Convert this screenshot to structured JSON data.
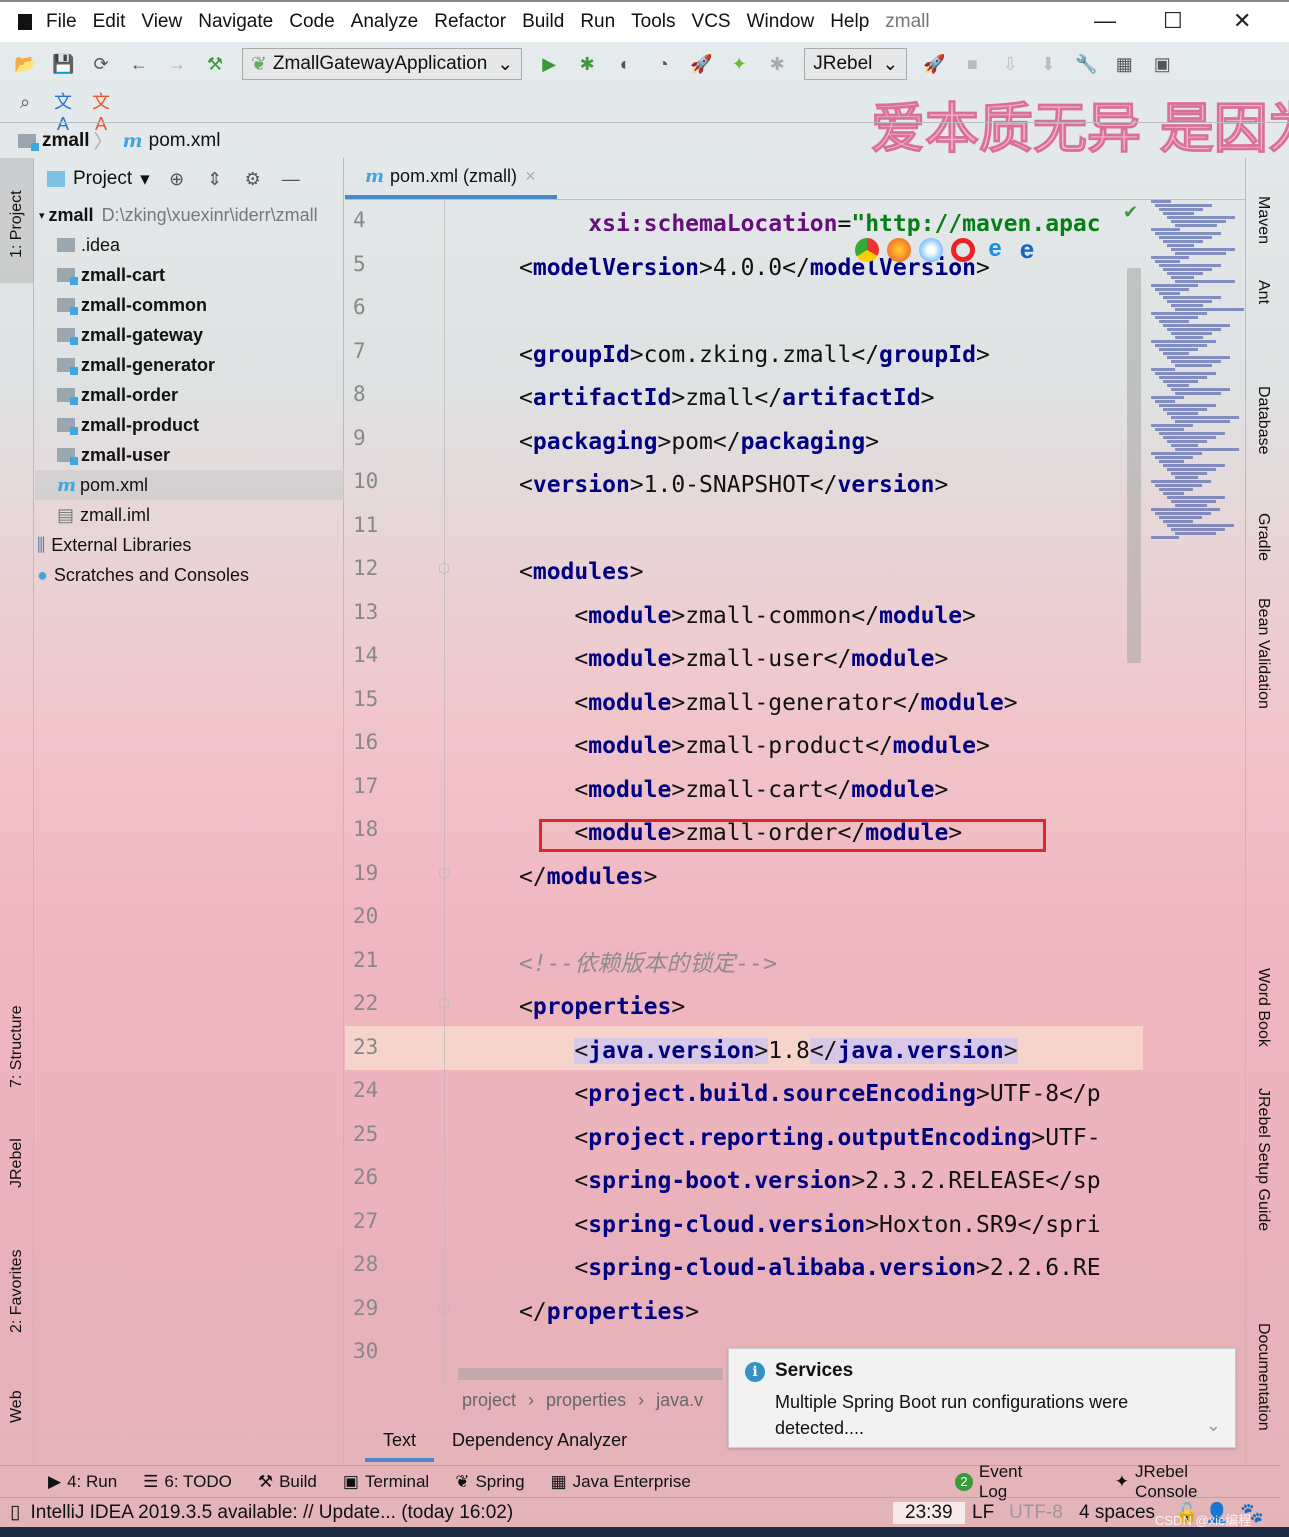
{
  "window": {
    "title": "zmall",
    "menu": [
      "File",
      "Edit",
      "View",
      "Navigate",
      "Code",
      "Analyze",
      "Refactor",
      "Build",
      "Run",
      "Tools",
      "VCS",
      "Window",
      "Help"
    ]
  },
  "toolbar": {
    "run_config": "ZmallGatewayApplication",
    "jrebel": "JRebel"
  },
  "watermark": "爱本质无异 是因为",
  "navbar": {
    "project": "zmall",
    "file": "pom.xml"
  },
  "left_stripe": [
    "1: Project",
    "7: Structure",
    "JRebel",
    "2: Favorites",
    "Web"
  ],
  "right_stripe": [
    "Maven",
    "Ant",
    "Database",
    "Gradle",
    "Bean Validation",
    "Word Book",
    "JRebel Setup Guide",
    "Documentation"
  ],
  "project_panel": {
    "title": "Project",
    "root": "zmall",
    "root_path": "D:\\zking\\xuexinr\\iderr\\zmall",
    "items": [
      {
        "label": ".idea",
        "type": "folder"
      },
      {
        "label": "zmall-cart",
        "type": "module"
      },
      {
        "label": "zmall-common",
        "type": "module"
      },
      {
        "label": "zmall-gateway",
        "type": "module"
      },
      {
        "label": "zmall-generator",
        "type": "module"
      },
      {
        "label": "zmall-order",
        "type": "module"
      },
      {
        "label": "zmall-product",
        "type": "module"
      },
      {
        "label": "zmall-user",
        "type": "module"
      },
      {
        "label": "pom.xml",
        "type": "maven",
        "selected": true
      },
      {
        "label": "zmall.iml",
        "type": "file"
      },
      {
        "label": "External Libraries",
        "type": "lib"
      },
      {
        "label": "Scratches and Consoles",
        "type": "scratch"
      }
    ]
  },
  "editor": {
    "tab": "pom.xml (zmall)",
    "current_line": 23,
    "lines": [
      {
        "n": "4",
        "indent": 5,
        "segs": [
          [
            "attr",
            "xsi:schemaLocation"
          ],
          [
            "txt",
            "="
          ],
          [
            "str",
            "\"http://maven.apac"
          ]
        ]
      },
      {
        "n": "5",
        "indent": 0,
        "segs": [
          [
            "txt",
            "<"
          ],
          [
            "tag",
            "modelVersion"
          ],
          [
            "txt",
            ">4.0.0</"
          ],
          [
            "tag",
            "modelVersion"
          ],
          [
            "txt",
            ">"
          ]
        ]
      },
      {
        "n": "6",
        "indent": 0,
        "segs": []
      },
      {
        "n": "7",
        "indent": 0,
        "segs": [
          [
            "txt",
            "<"
          ],
          [
            "tag",
            "groupId"
          ],
          [
            "txt",
            ">com.zking.zmall</"
          ],
          [
            "tag",
            "groupId"
          ],
          [
            "txt",
            ">"
          ]
        ]
      },
      {
        "n": "8",
        "indent": 0,
        "segs": [
          [
            "txt",
            "<"
          ],
          [
            "tag",
            "artifactId"
          ],
          [
            "txt",
            ">zmall</"
          ],
          [
            "tag",
            "artifactId"
          ],
          [
            "txt",
            ">"
          ]
        ]
      },
      {
        "n": "9",
        "indent": 0,
        "segs": [
          [
            "txt",
            "<"
          ],
          [
            "tag",
            "packaging"
          ],
          [
            "txt",
            ">pom</"
          ],
          [
            "tag",
            "packaging"
          ],
          [
            "txt",
            ">"
          ]
        ]
      },
      {
        "n": "10",
        "indent": 0,
        "segs": [
          [
            "txt",
            "<"
          ],
          [
            "tag",
            "version"
          ],
          [
            "txt",
            ">1.0-SNAPSHOT</"
          ],
          [
            "tag",
            "version"
          ],
          [
            "txt",
            ">"
          ]
        ]
      },
      {
        "n": "11",
        "indent": 0,
        "segs": []
      },
      {
        "n": "12",
        "indent": 0,
        "segs": [
          [
            "txt",
            "<"
          ],
          [
            "tag",
            "modules"
          ],
          [
            "txt",
            ">"
          ]
        ]
      },
      {
        "n": "13",
        "indent": 4,
        "segs": [
          [
            "txt",
            "<"
          ],
          [
            "tag",
            "module"
          ],
          [
            "txt",
            ">zmall-common</"
          ],
          [
            "tag",
            "module"
          ],
          [
            "txt",
            ">"
          ]
        ]
      },
      {
        "n": "14",
        "indent": 4,
        "segs": [
          [
            "txt",
            "<"
          ],
          [
            "tag",
            "module"
          ],
          [
            "txt",
            ">zmall-user</"
          ],
          [
            "tag",
            "module"
          ],
          [
            "txt",
            ">"
          ]
        ]
      },
      {
        "n": "15",
        "indent": 4,
        "segs": [
          [
            "txt",
            "<"
          ],
          [
            "tag",
            "module"
          ],
          [
            "txt",
            ">zmall-generator</"
          ],
          [
            "tag",
            "module"
          ],
          [
            "txt",
            ">"
          ]
        ]
      },
      {
        "n": "16",
        "indent": 4,
        "segs": [
          [
            "txt",
            "<"
          ],
          [
            "tag",
            "module"
          ],
          [
            "txt",
            ">zmall-product</"
          ],
          [
            "tag",
            "module"
          ],
          [
            "txt",
            ">"
          ]
        ]
      },
      {
        "n": "17",
        "indent": 4,
        "segs": [
          [
            "txt",
            "<"
          ],
          [
            "tag",
            "module"
          ],
          [
            "txt",
            ">zmall-cart</"
          ],
          [
            "tag",
            "module"
          ],
          [
            "txt",
            ">"
          ]
        ]
      },
      {
        "n": "18",
        "indent": 4,
        "segs": [
          [
            "txt",
            "<"
          ],
          [
            "tag",
            "module"
          ],
          [
            "txt",
            ">zmall-order</"
          ],
          [
            "tag",
            "module"
          ],
          [
            "txt",
            ">"
          ]
        ]
      },
      {
        "n": "19",
        "indent": 0,
        "segs": [
          [
            "txt",
            "</"
          ],
          [
            "tag",
            "modules"
          ],
          [
            "txt",
            ">"
          ]
        ]
      },
      {
        "n": "20",
        "indent": 0,
        "segs": []
      },
      {
        "n": "21",
        "indent": 0,
        "segs": [
          [
            "cmt",
            "<!--依赖版本的锁定-->"
          ]
        ]
      },
      {
        "n": "22",
        "indent": 0,
        "segs": [
          [
            "txt",
            "<"
          ],
          [
            "tag",
            "properties"
          ],
          [
            "txt",
            ">"
          ]
        ]
      },
      {
        "n": "23",
        "indent": 4,
        "segs": [
          [
            "hl",
            "<"
          ],
          [
            "hltag",
            "java.version"
          ],
          [
            "hl",
            ">"
          ],
          [
            "txt",
            "1.8"
          ],
          [
            "hl",
            "</"
          ],
          [
            "hltag",
            "java.version"
          ],
          [
            "hl",
            ">"
          ]
        ]
      },
      {
        "n": "24",
        "indent": 4,
        "segs": [
          [
            "txt",
            "<"
          ],
          [
            "tag",
            "project.build.sourceEncoding"
          ],
          [
            "txt",
            ">UTF-8</p"
          ]
        ]
      },
      {
        "n": "25",
        "indent": 4,
        "segs": [
          [
            "txt",
            "<"
          ],
          [
            "tag",
            "project.reporting.outputEncoding"
          ],
          [
            "txt",
            ">UTF-"
          ]
        ]
      },
      {
        "n": "26",
        "indent": 4,
        "segs": [
          [
            "txt",
            "<"
          ],
          [
            "tag",
            "spring-boot.version"
          ],
          [
            "txt",
            ">2.3.2.RELEASE</sp"
          ]
        ]
      },
      {
        "n": "27",
        "indent": 4,
        "segs": [
          [
            "txt",
            "<"
          ],
          [
            "tag",
            "spring-cloud.version"
          ],
          [
            "txt",
            ">Hoxton.SR9</spri"
          ]
        ]
      },
      {
        "n": "28",
        "indent": 4,
        "segs": [
          [
            "txt",
            "<"
          ],
          [
            "tag",
            "spring-cloud-alibaba.version"
          ],
          [
            "txt",
            ">2.2.6.RE"
          ]
        ]
      },
      {
        "n": "29",
        "indent": 0,
        "segs": [
          [
            "txt",
            "</"
          ],
          [
            "tag",
            "properties"
          ],
          [
            "txt",
            ">"
          ]
        ]
      },
      {
        "n": "30",
        "indent": 0,
        "segs": []
      }
    ],
    "breadcrumbs": [
      "project",
      "properties",
      "java.v"
    ],
    "bottom_tabs": [
      "Text",
      "Dependency Analyzer"
    ]
  },
  "notification": {
    "title": "Services",
    "body": "Multiple Spring Boot run configurations were detected...."
  },
  "tool_windows": {
    "left": [
      {
        "label": "4: Run"
      },
      {
        "label": "6: TODO"
      },
      {
        "label": "Build"
      },
      {
        "label": "Terminal"
      },
      {
        "label": "Spring"
      },
      {
        "label": "Java Enterprise"
      }
    ],
    "event_log": "Event Log",
    "event_count": "2",
    "jrebel_console": "JRebel Console"
  },
  "status": {
    "message": "IntelliJ IDEA 2019.3.5 available: // Update... (today 16:02)",
    "position": "23:39",
    "line_sep": "LF",
    "encoding": "UTF-8",
    "indent": "4 spaces",
    "credit": "CSDN @xie编程"
  },
  "colors": {
    "tag": "#000080",
    "attr": "#660e7a",
    "string": "#067d17",
    "comment": "#8c8c8c",
    "highlight_box": "#e0262a",
    "accent": "#4a88c7"
  }
}
